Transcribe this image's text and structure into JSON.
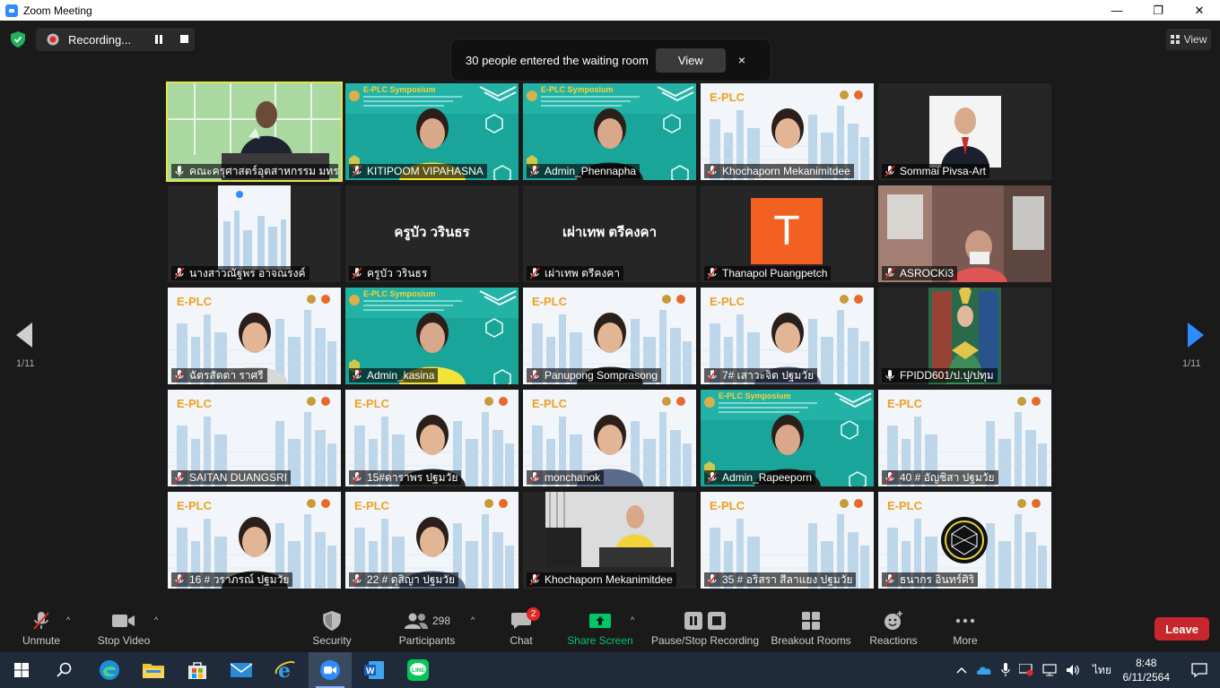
{
  "window": {
    "title": "Zoom Meeting",
    "minimize": "—",
    "maximize": "❐",
    "close": "✕"
  },
  "recording": {
    "label": "Recording..."
  },
  "view_button": {
    "label": "View"
  },
  "notification": {
    "text": "30 people entered the waiting room",
    "view_label": "View",
    "close": "×"
  },
  "pagination": {
    "left": "1/11",
    "right": "1/11"
  },
  "tiles": [
    {
      "name": "คณะครุศาสตร์อุตสาหกรรม มทร...",
      "muted": false,
      "kind": "camera-room"
    },
    {
      "name": "KITIPOOM VIPAHASNA",
      "muted": true,
      "kind": "camera-symposium"
    },
    {
      "name": "Admin_Phennapha",
      "muted": true,
      "kind": "camera-symposium"
    },
    {
      "name": "Khochaporn Mekanimitdee",
      "muted": true,
      "kind": "camera-eplc"
    },
    {
      "name": "Sommai Pivsa-Art",
      "muted": true,
      "kind": "photo-portrait"
    },
    {
      "name": "นางสาวณัฐพร อาจณรงค์",
      "muted": true,
      "kind": "poster"
    },
    {
      "name": "ครูบัว วรินธร",
      "muted": true,
      "kind": "name-only",
      "big": "ครูบัว วรินธร"
    },
    {
      "name": "เผ่าเทพ  ตรีคงคา",
      "muted": true,
      "kind": "name-only",
      "big": "เผ่าเทพ  ตรีคงคา"
    },
    {
      "name": "Thanapol Puangpetch",
      "muted": true,
      "kind": "avatar",
      "avatar_letter": "T"
    },
    {
      "name": "ASROCKi3",
      "muted": true,
      "kind": "camera-home"
    },
    {
      "name": "ฉัตรสัตตา ราศรี",
      "muted": true,
      "kind": "camera-eplc"
    },
    {
      "name": "Admin_kasina",
      "muted": true,
      "kind": "camera-symposium"
    },
    {
      "name": "Panupong Somprasong",
      "muted": true,
      "kind": "camera-eplc"
    },
    {
      "name": "7# เสาวะจิต ปฐมวัย",
      "muted": true,
      "kind": "camera-eplc"
    },
    {
      "name": "FPIDD601/ป.ปุ/ปทุม",
      "muted": false,
      "kind": "photo-costume"
    },
    {
      "name": "SAITAN DUANGSRI",
      "muted": true,
      "kind": "camera-eplc-empty"
    },
    {
      "name": "15#ดาราพร ปฐมวัย",
      "muted": true,
      "kind": "camera-eplc"
    },
    {
      "name": "monchanok",
      "muted": true,
      "kind": "camera-eplc"
    },
    {
      "name": "Admin_Rapeeporn",
      "muted": true,
      "kind": "camera-symposium"
    },
    {
      "name": "40 # อัญชิสา ปฐมวัย",
      "muted": true,
      "kind": "camera-eplc-empty"
    },
    {
      "name": "16 # วราภรณ์ ปฐมวัย",
      "muted": true,
      "kind": "camera-eplc"
    },
    {
      "name": "22 # ดุสิญา  ปฐมวัย",
      "muted": true,
      "kind": "camera-eplc"
    },
    {
      "name": "Khochaporn Mekanimitdee",
      "muted": true,
      "kind": "camera-office"
    },
    {
      "name": "35 # อริสรา สีลาแยง ปฐมวัย",
      "muted": true,
      "kind": "camera-eplc-empty"
    },
    {
      "name": "ธนากร อินทร์ศิริ",
      "muted": true,
      "kind": "camera-eplc-logo"
    }
  ],
  "toolbar": {
    "unmute": "Unmute",
    "stop_video": "Stop Video",
    "security": "Security",
    "participants": "Participants",
    "participants_count": "298",
    "chat": "Chat",
    "chat_badge": "2",
    "share": "Share Screen",
    "recording": "Pause/Stop Recording",
    "breakout": "Breakout Rooms",
    "reactions": "Reactions",
    "more": "More",
    "leave": "Leave",
    "caret": "^"
  },
  "taskbar": {
    "apps": [
      "start-icon",
      "search-icon",
      "edge-icon",
      "file-explorer-icon",
      "store-icon",
      "mail-icon",
      "ie-icon",
      "zoom-icon",
      "word-icon",
      "line-icon"
    ],
    "lang": "ไทย",
    "time": "8:48",
    "date": "6/11/2564"
  },
  "colors": {
    "active_speaker": "#e4e44a",
    "leave": "#c6262c",
    "share": "#00c76a",
    "avatar": "#f26122"
  }
}
